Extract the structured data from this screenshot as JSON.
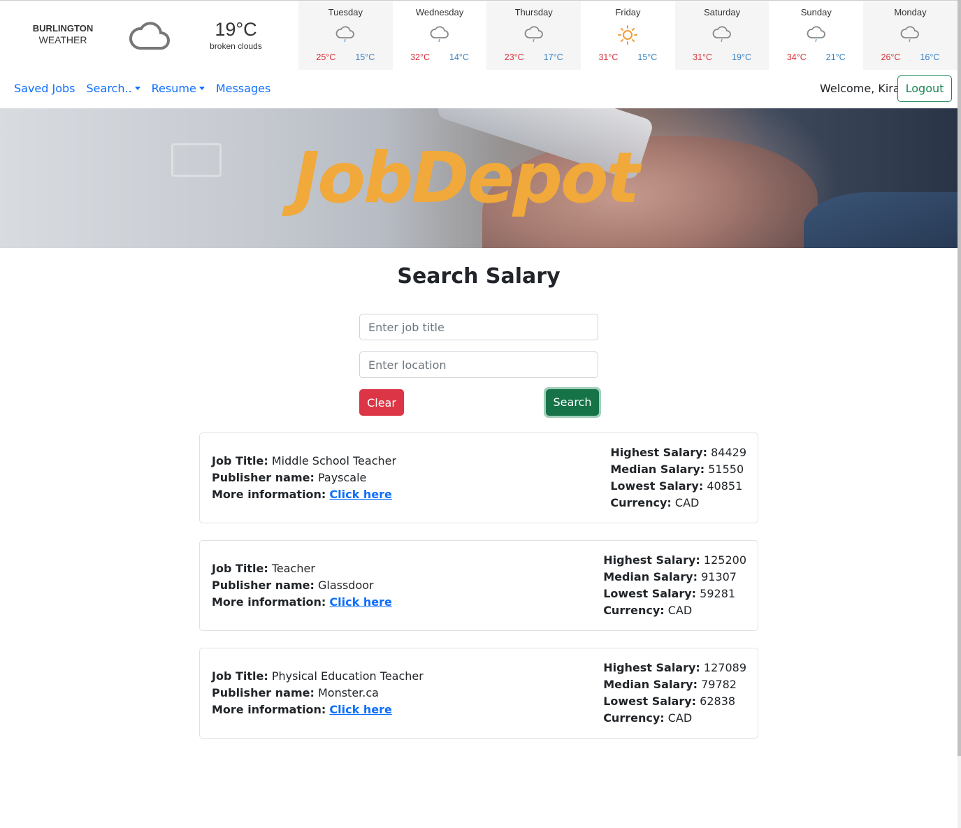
{
  "weather": {
    "city": "BURLINGTON",
    "label": "WEATHER",
    "current_icon": "cloud-icon",
    "current_temp": "19°C",
    "current_desc": "broken clouds",
    "forecast": [
      {
        "day": "Tuesday",
        "icon": "rain-cloud-icon",
        "high": "25°C",
        "low": "15°C"
      },
      {
        "day": "Wednesday",
        "icon": "rain-cloud-icon",
        "high": "32°C",
        "low": "14°C"
      },
      {
        "day": "Thursday",
        "icon": "rain-cloud-icon",
        "high": "23°C",
        "low": "17°C"
      },
      {
        "day": "Friday",
        "icon": "sun-icon",
        "high": "31°C",
        "low": "15°C"
      },
      {
        "day": "Saturday",
        "icon": "rain-cloud-icon",
        "high": "31°C",
        "low": "19°C"
      },
      {
        "day": "Sunday",
        "icon": "rain-cloud-icon",
        "high": "34°C",
        "low": "21°C"
      },
      {
        "day": "Monday",
        "icon": "rain-cloud-icon",
        "high": "26°C",
        "low": "16°C"
      }
    ]
  },
  "nav": {
    "saved_jobs": "Saved Jobs",
    "search": "Search..",
    "resume": "Resume",
    "messages": "Messages",
    "welcome": "Welcome, Kira",
    "logout": "Logout"
  },
  "banner": {
    "logo": "JobDepot"
  },
  "main": {
    "title": "Search Salary",
    "job_placeholder": "Enter job title",
    "location_placeholder": "Enter location",
    "clear_label": "Clear",
    "search_label": "Search"
  },
  "labels": {
    "job_title": "Job Title:",
    "publisher": "Publisher name:",
    "more_info": "More information:",
    "link": "Click here",
    "highest": "Highest Salary:",
    "median": "Median Salary:",
    "lowest": "Lowest Salary:",
    "currency": "Currency:"
  },
  "results": [
    {
      "job_title": "Middle School Teacher",
      "publisher": "Payscale",
      "highest": "84429",
      "median": "51550",
      "lowest": "40851",
      "currency": "CAD"
    },
    {
      "job_title": "Teacher",
      "publisher": "Glassdoor",
      "highest": "125200",
      "median": "91307",
      "lowest": "59281",
      "currency": "CAD"
    },
    {
      "job_title": "Physical Education Teacher",
      "publisher": "Monster.ca",
      "highest": "127089",
      "median": "79782",
      "lowest": "62838",
      "currency": "CAD"
    }
  ],
  "colors": {
    "accent": "#0d6efd",
    "success": "#198754",
    "danger": "#dc3545",
    "logo": "#f0a93a"
  }
}
